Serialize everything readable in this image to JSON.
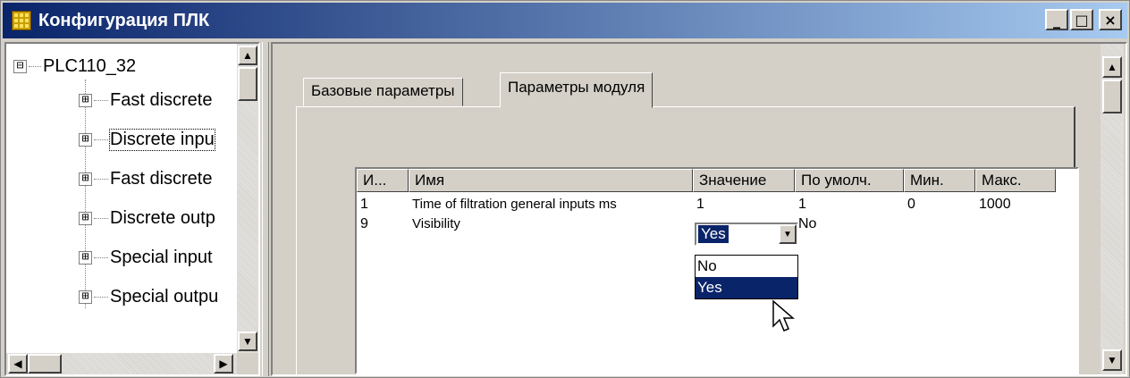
{
  "window": {
    "title": "Конфигурация ПЛК",
    "minimize": "_",
    "maximize": "□",
    "close": "×"
  },
  "tree": {
    "root": {
      "label": "PLC110_32",
      "expander": "⊟"
    },
    "children": [
      {
        "label": "Fast discrete",
        "expander": "⊞"
      },
      {
        "label": "Discrete inpu",
        "expander": "⊞"
      },
      {
        "label": "Fast discrete",
        "expander": "⊞"
      },
      {
        "label": "Discrete outp",
        "expander": "⊞"
      },
      {
        "label": "Special input",
        "expander": "⊞"
      },
      {
        "label": "Special outpu",
        "expander": "⊞"
      }
    ]
  },
  "tabs": [
    {
      "label": "Базовые параметры",
      "active": false
    },
    {
      "label": "Параметры модуля",
      "active": true
    }
  ],
  "grid": {
    "columns": [
      "И...",
      "Имя",
      "Значение",
      "По умолч.",
      "Мин.",
      "Макс."
    ],
    "rows": [
      [
        "1",
        "Time of filtration general inputs ms",
        "1",
        "1",
        "0",
        "1000"
      ],
      [
        "9",
        "Visibility",
        "",
        "No",
        "",
        ""
      ]
    ]
  },
  "combo": {
    "value": "Yes",
    "options": [
      "No",
      "Yes"
    ],
    "selected": "Yes"
  },
  "icons": {
    "arrow_up": "▲",
    "arrow_down": "▼",
    "arrow_left": "◀",
    "arrow_right": "▶"
  },
  "colors": {
    "title_start": "#0a246a",
    "title_end": "#a6caf0",
    "selection": "#0a246a",
    "face": "#d4d0c8"
  }
}
